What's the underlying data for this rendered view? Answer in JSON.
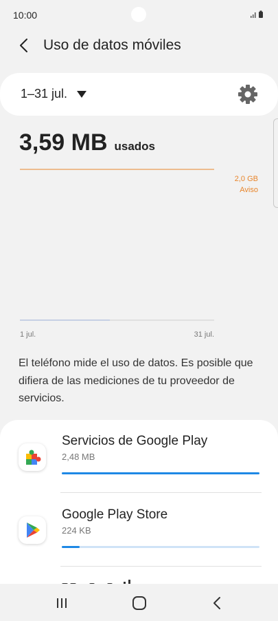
{
  "status_bar": {
    "time": "10:00"
  },
  "header": {
    "title": "Uso de datos móviles"
  },
  "period": {
    "label": "1–31 jul."
  },
  "usage": {
    "value": "3,59 MB",
    "unit": "usados"
  },
  "chart_data": {
    "type": "area",
    "x_tick_labels": [
      "1 jul.",
      "31 jul."
    ],
    "warning_line": {
      "value_label": "2,0 GB",
      "label": "Aviso",
      "color": "#e8852b"
    },
    "usage_line_color": "#9aaed6"
  },
  "description": "El teléfono mide el uso de datos. Es posible que difiera de las mediciones de tu proveedor de servicios.",
  "apps": [
    {
      "name": "Servicios de Google Play",
      "size": "2,48 MB",
      "share": 1.0
    },
    {
      "name": "Google Play Store",
      "size": "224 KB",
      "share": 0.09
    }
  ],
  "colors": {
    "accent": "#1e88e5",
    "warning": "#e8852b"
  }
}
